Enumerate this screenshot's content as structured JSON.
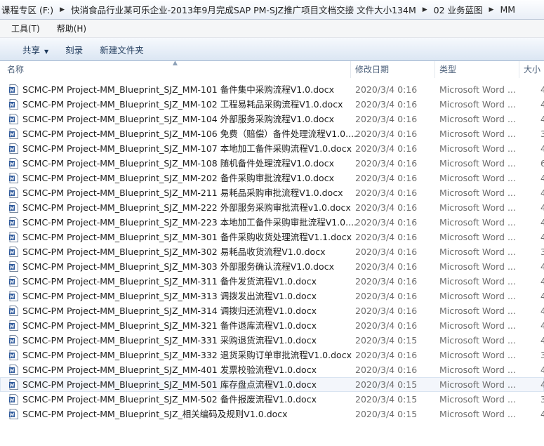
{
  "address": {
    "crumbs": [
      "课程专区 (F:)",
      "快消食品行业某可乐企业-2013年9月完成SAP PM-SJZ推广项目文档交接 文件大小134M",
      "02 业务蓝图",
      "MM"
    ]
  },
  "menu": [
    "工具(T)",
    "帮助(H)"
  ],
  "toolbar": {
    "share": "共享",
    "burn": "刻录",
    "new_folder": "新建文件夹"
  },
  "columns": {
    "name": "名称",
    "date": "修改日期",
    "type": "类型",
    "size": "大小"
  },
  "files": [
    {
      "name": "SCMC-PM Project-MM_Blueprint_SJZ_MM-101 备件集中采购流程V1.0.docx",
      "date": "2020/3/4 0:16",
      "type": "Microsoft Word ...",
      "size": "4"
    },
    {
      "name": "SCMC-PM Project-MM_Blueprint_SJZ_MM-102 工程易耗品采购流程V1.0.docx",
      "date": "2020/3/4 0:16",
      "type": "Microsoft Word ...",
      "size": "4"
    },
    {
      "name": "SCMC-PM Project-MM_Blueprint_SJZ_MM-104 外部服务采购流程V1.0.docx",
      "date": "2020/3/4 0:16",
      "type": "Microsoft Word ...",
      "size": "4"
    },
    {
      "name": "SCMC-PM Project-MM_Blueprint_SJZ_MM-106 免费（赔偿）备件处理流程V1.0....",
      "date": "2020/3/4 0:16",
      "type": "Microsoft Word ...",
      "size": "3"
    },
    {
      "name": "SCMC-PM Project-MM_Blueprint_SJZ_MM-107 本地加工备件采购流程V1.0.docx",
      "date": "2020/3/4 0:16",
      "type": "Microsoft Word ...",
      "size": "4"
    },
    {
      "name": "SCMC-PM Project-MM_Blueprint_SJZ_MM-108 随机备件处理流程V1.0.docx",
      "date": "2020/3/4 0:16",
      "type": "Microsoft Word ...",
      "size": "6"
    },
    {
      "name": "SCMC-PM Project-MM_Blueprint_SJZ_MM-202 备件采购审批流程V1.0.docx",
      "date": "2020/3/4 0:16",
      "type": "Microsoft Word ...",
      "size": "4"
    },
    {
      "name": "SCMC-PM Project-MM_Blueprint_SJZ_MM-211 易耗品采购审批流程V1.0.docx",
      "date": "2020/3/4 0:16",
      "type": "Microsoft Word ...",
      "size": "4"
    },
    {
      "name": "SCMC-PM Project-MM_Blueprint_SJZ_MM-222 外部服务采购审批流程v1.0.docx",
      "date": "2020/3/4 0:16",
      "type": "Microsoft Word ...",
      "size": "4"
    },
    {
      "name": "SCMC-PM Project-MM_Blueprint_SJZ_MM-223 本地加工备件采购审批流程V1.0....",
      "date": "2020/3/4 0:16",
      "type": "Microsoft Word ...",
      "size": "4"
    },
    {
      "name": "SCMC-PM Project-MM_Blueprint_SJZ_MM-301 备件采购收货处理流程V1.1.docx",
      "date": "2020/3/4 0:16",
      "type": "Microsoft Word ...",
      "size": "4"
    },
    {
      "name": "SCMC-PM Project-MM_Blueprint_SJZ_MM-302 易耗品收货流程V1.0.docx",
      "date": "2020/3/4 0:16",
      "type": "Microsoft Word ...",
      "size": "3"
    },
    {
      "name": "SCMC-PM Project-MM_Blueprint_SJZ_MM-303 外部服务确认流程V1.0.docx",
      "date": "2020/3/4 0:16",
      "type": "Microsoft Word ...",
      "size": "4"
    },
    {
      "name": "SCMC-PM Project-MM_Blueprint_SJZ_MM-311 备件发货流程V1.0.docx",
      "date": "2020/3/4 0:16",
      "type": "Microsoft Word ...",
      "size": "4"
    },
    {
      "name": "SCMC-PM Project-MM_Blueprint_SJZ_MM-313 调拨发出流程V1.0.docx",
      "date": "2020/3/4 0:16",
      "type": "Microsoft Word ...",
      "size": "4"
    },
    {
      "name": "SCMC-PM Project-MM_Blueprint_SJZ_MM-314 调拨归还流程V1.0.docx",
      "date": "2020/3/4 0:16",
      "type": "Microsoft Word ...",
      "size": "4"
    },
    {
      "name": "SCMC-PM Project-MM_Blueprint_SJZ_MM-321 备件退库流程V1.0.docx",
      "date": "2020/3/4 0:16",
      "type": "Microsoft Word ...",
      "size": "4"
    },
    {
      "name": "SCMC-PM Project-MM_Blueprint_SJZ_MM-331 采购退货流程V1.0.docx",
      "date": "2020/3/4 0:15",
      "type": "Microsoft Word ...",
      "size": "4"
    },
    {
      "name": "SCMC-PM Project-MM_Blueprint_SJZ_MM-332 退货采购订单审批流程V1.0.docx",
      "date": "2020/3/4 0:16",
      "type": "Microsoft Word ...",
      "size": "3"
    },
    {
      "name": "SCMC-PM Project-MM_Blueprint_SJZ_MM-401 发票校验流程V1.0.docx",
      "date": "2020/3/4 0:16",
      "type": "Microsoft Word ...",
      "size": "4"
    },
    {
      "name": "SCMC-PM Project-MM_Blueprint_SJZ_MM-501 库存盘点流程V1.0.docx",
      "date": "2020/3/4 0:15",
      "type": "Microsoft Word ...",
      "size": "4"
    },
    {
      "name": "SCMC-PM Project-MM_Blueprint_SJZ_MM-502 备件报废流程V1.0.docx",
      "date": "2020/3/4 0:15",
      "type": "Microsoft Word ...",
      "size": "3"
    },
    {
      "name": "SCMC-PM Project-MM_Blueprint_SJZ_相关编码及规则V1.0.docx",
      "date": "2020/3/4 0:15",
      "type": "Microsoft Word ...",
      "size": "4"
    }
  ],
  "selected_index": 20,
  "colors": {
    "accent": "#1e395b",
    "word_icon": "#2b579a"
  },
  "icons": {
    "file": "word-document-icon",
    "breadcrumb_separator": "chevron-right-icon"
  }
}
